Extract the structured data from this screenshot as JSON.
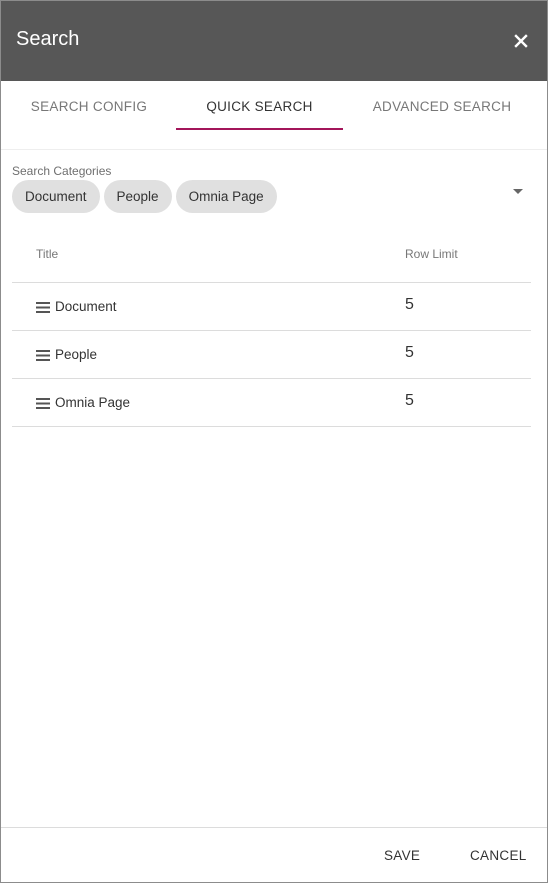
{
  "header": {
    "title": "Search",
    "close_icon": "close-icon",
    "background": "#575757"
  },
  "tabs": [
    {
      "label": "SEARCH CONFIG",
      "active": false
    },
    {
      "label": "QUICK SEARCH",
      "active": true
    },
    {
      "label": "ADVANCED SEARCH",
      "active": false
    }
  ],
  "accent_color": "#a3155a",
  "categories": {
    "label": "Search Categories",
    "chips": [
      "Document",
      "People",
      "Omnia Page"
    ],
    "dropdown_icon": "dropdown-arrow-icon"
  },
  "table": {
    "columns": {
      "title": "Title",
      "row_limit": "Row Limit"
    },
    "rows": [
      {
        "title": "Document",
        "row_limit": "5"
      },
      {
        "title": "People",
        "row_limit": "5"
      },
      {
        "title": "Omnia Page",
        "row_limit": "5"
      }
    ],
    "drag_icon": "drag-handle-icon"
  },
  "footer": {
    "save_label": "SAVE",
    "cancel_label": "CANCEL"
  }
}
